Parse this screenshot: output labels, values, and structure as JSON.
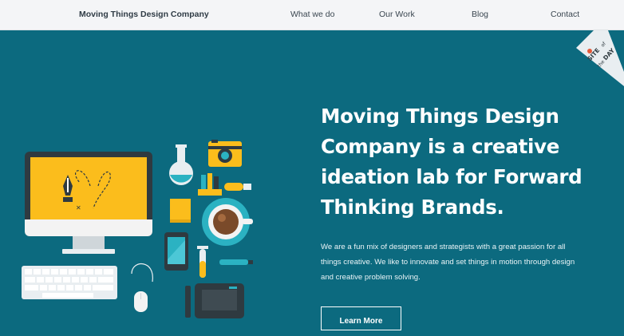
{
  "header": {
    "brand": "Moving Things Design Company",
    "nav": [
      "What we do",
      "Our Work",
      "Blog",
      "Contact"
    ]
  },
  "hero": {
    "headline_lines": [
      "Moving Things Design",
      "Company is a creative",
      "ideation lab for Forward",
      "Thinking Brands."
    ],
    "intro_lines": [
      "We are a fun mix of designers and strategists with a great passion for all",
      "things creative. We like to innovate and set things in motion through design",
      "and creative problem solving."
    ],
    "cta_label": "Learn More"
  },
  "badge": {
    "line1": "SITE",
    "line2": "of",
    "line3": "the",
    "line4": "DAY"
  },
  "colors": {
    "background": "#0c6a7f",
    "nav_bg": "#f4f5f7",
    "accent_yellow": "#fbbd1c",
    "monitor_dark": "#2f3a40"
  }
}
